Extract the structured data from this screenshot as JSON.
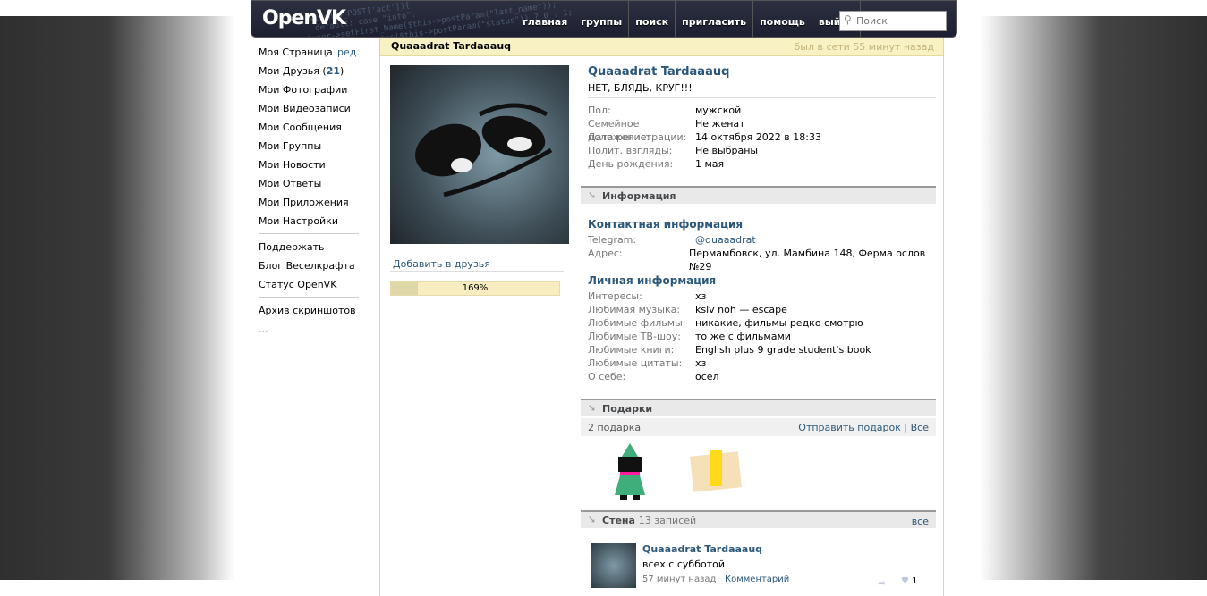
{
  "header": {
    "logo": "OpenVK",
    "nav": [
      "главная",
      "группы",
      "поиск",
      "пригласить",
      "помощь",
      "выйти"
    ],
    "search_placeholder": "Поиск"
  },
  "sidebar": {
    "my_page": "Моя Страница",
    "edit": "ред.",
    "friends": "Мои Друзья",
    "friends_count": "21",
    "items": [
      "Мои Фотографии",
      "Мои Видеозаписи",
      "Мои Сообщения",
      "Мои Группы",
      "Мои Новости",
      "Мои Ответы",
      "Мои Приложения",
      "Мои Настройки"
    ],
    "extra": [
      "Поддержать",
      "Блог Веселкрафта",
      "Статус OpenVK"
    ],
    "archive": "Архив скриншотов ..."
  },
  "profile": {
    "title": "Quaaadrat Tardaaauq",
    "online": "был в сети 55 минут назад",
    "name": "Quaaadrat Tardaaauq",
    "status": "НЕТ, БЛЯДЬ, КРУГ!!!",
    "add_friend": "Добавить в друзья",
    "completeness": "169%",
    "completeness_fraction": 1.0,
    "basic": [
      [
        "Пол:",
        "мужской"
      ],
      [
        "Семейное положение:",
        "Не женат"
      ],
      [
        "Дата регистрации:",
        "14 октября 2022 в 18:33"
      ],
      [
        "Полит. взгляды:",
        "Не выбраны"
      ],
      [
        "День рождения:",
        "1 мая"
      ]
    ],
    "info_header": "Информация",
    "contact_header": "Контактная информация",
    "contact": [
      [
        "Telegram:",
        "@quaaadrat"
      ],
      [
        "Адрес:",
        "Пермамбовск, ул. Мамбина 148, Ферма ослов №29"
      ]
    ],
    "personal_header": "Личная информация",
    "personal": [
      [
        "Интересы:",
        "хз"
      ],
      [
        "Любимая музыка:",
        "kslv noh — escape"
      ],
      [
        "Любимые фильмы:",
        "никакие, фильмы редко смотрю"
      ],
      [
        "Любимые ТВ-шоу:",
        "то же с фильмами"
      ],
      [
        "Любимые книги:",
        "English plus 9 grade student's book"
      ],
      [
        "Любимые цитаты:",
        "хз"
      ],
      [
        "О себе:",
        "осел"
      ]
    ]
  },
  "gifts": {
    "header": "Подарки",
    "count": "2 подарка",
    "send": "Отправить подарок",
    "sep": "|",
    "all": "Все"
  },
  "wall": {
    "header": "Стена",
    "count": "13 записей",
    "all": "все",
    "post": {
      "author": "Quaaadrat Tardaaauq",
      "text": "всех с субботой",
      "time": "57 минут назад",
      "comment": "Комментарий",
      "likes": "1"
    }
  }
}
